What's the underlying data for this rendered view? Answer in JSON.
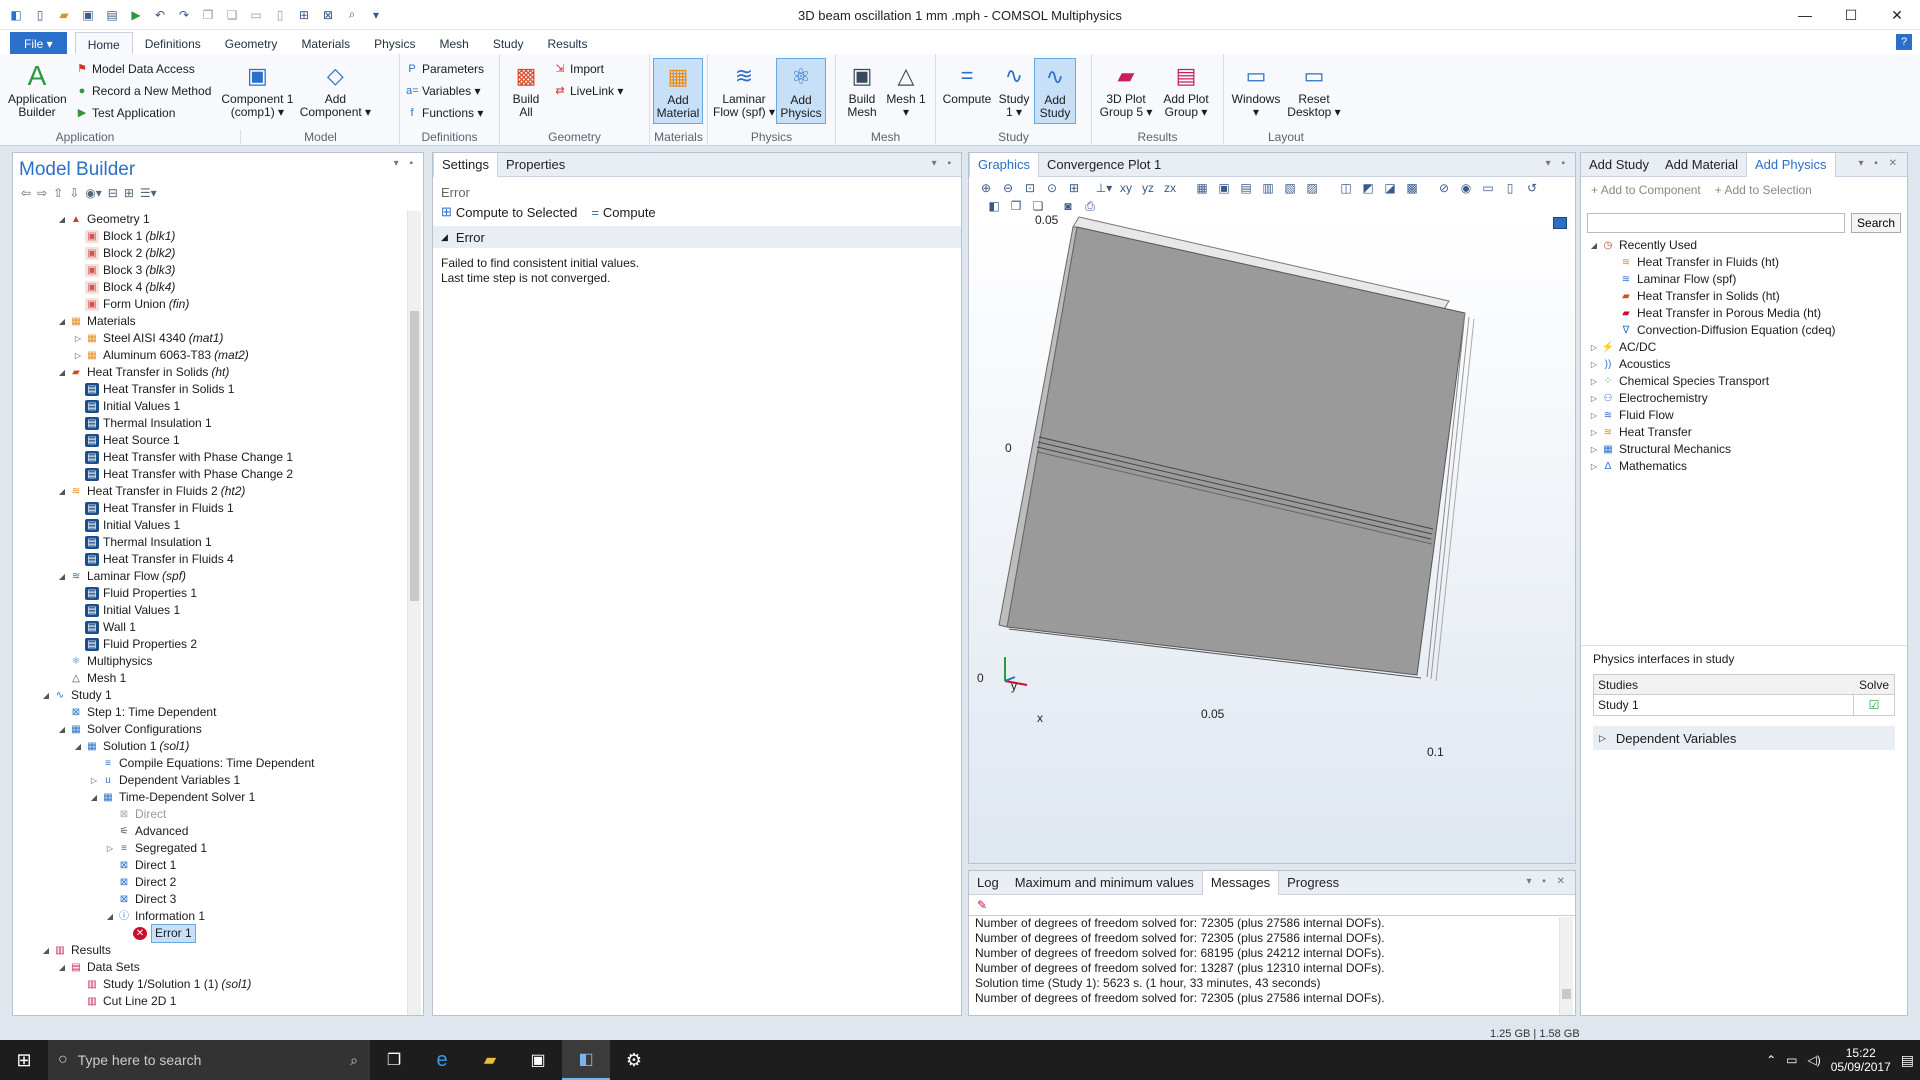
{
  "window": {
    "title": "3D beam oscillation 1 mm .mph - COMSOL Multiphysics"
  },
  "qat_icons": [
    "comsol-logo-icon",
    "new-icon",
    "open-icon",
    "save-icon",
    "save-as-icon",
    "run-icon",
    "undo-icon",
    "redo-icon",
    "copy-icon",
    "duplicate-icon",
    "paste-icon",
    "delete-icon",
    "select-all-icon",
    "clear-icon",
    "zoom-icon",
    "more-icon"
  ],
  "ribbon_tabs": {
    "file": "File ▾",
    "tabs": [
      "Home",
      "Definitions",
      "Geometry",
      "Materials",
      "Physics",
      "Mesh",
      "Study",
      "Results"
    ],
    "active": "Home"
  },
  "ribbon": {
    "application": {
      "label": "Application",
      "app_builder": "Application Builder",
      "model_data_access": "Model Data Access",
      "record_method": "Record a New Method",
      "test_app": "Test Application"
    },
    "model": {
      "label": "Model",
      "component": "Component 1 (comp1) ▾",
      "add_component": "Add Component ▾"
    },
    "definitions": {
      "label": "Definitions",
      "parameters": "Parameters",
      "variables": "Variables ▾",
      "functions": "Functions ▾"
    },
    "geometry": {
      "label": "Geometry",
      "build_all": "Build All",
      "import": "Import",
      "livelink": "LiveLink ▾"
    },
    "materials": {
      "label": "Materials",
      "add_material": "Add Material"
    },
    "physics": {
      "label": "Physics",
      "laminar_flow": "Laminar Flow (spf) ▾",
      "add_physics": "Add Physics"
    },
    "mesh": {
      "label": "Mesh",
      "build_mesh": "Build Mesh",
      "mesh1": "Mesh 1 ▾"
    },
    "study": {
      "label": "Study",
      "compute": "Compute",
      "study1": "Study 1 ▾",
      "add_study": "Add Study"
    },
    "results": {
      "label": "Results",
      "plot_group": "3D Plot Group 5 ▾",
      "add_plot_group": "Add Plot Group ▾"
    },
    "layout": {
      "label": "Layout",
      "windows": "Windows ▾",
      "reset_desktop": "Reset Desktop ▾"
    }
  },
  "model_builder": {
    "title": "Model Builder",
    "tree": [
      {
        "indent": 3,
        "arrow": "◢",
        "icon": "geometry",
        "label": "Geometry 1",
        "tag": ""
      },
      {
        "indent": 4,
        "arrow": "",
        "icon": "block",
        "label": "Block 1",
        "tag": "(blk1)"
      },
      {
        "indent": 4,
        "arrow": "",
        "icon": "block",
        "label": "Block 2",
        "tag": "(blk2)"
      },
      {
        "indent": 4,
        "arrow": "",
        "icon": "block",
        "label": "Block 3",
        "tag": "(blk3)"
      },
      {
        "indent": 4,
        "arrow": "",
        "icon": "block",
        "label": "Block 4",
        "tag": "(blk4)"
      },
      {
        "indent": 4,
        "arrow": "",
        "icon": "block",
        "label": "Form Union",
        "tag": "(fin)"
      },
      {
        "indent": 3,
        "arrow": "◢",
        "icon": "material",
        "label": "Materials",
        "tag": ""
      },
      {
        "indent": 4,
        "arrow": "▷",
        "icon": "material",
        "label": "Steel AISI 4340",
        "tag": "(mat1)"
      },
      {
        "indent": 4,
        "arrow": "▷",
        "icon": "material",
        "label": "Aluminum 6063-T83",
        "tag": "(mat2)"
      },
      {
        "indent": 3,
        "arrow": "◢",
        "icon": "heat",
        "label": "Heat Transfer in Solids",
        "tag": "(ht)"
      },
      {
        "indent": 4,
        "arrow": "",
        "icon": "node",
        "label": "Heat Transfer in Solids 1",
        "tag": ""
      },
      {
        "indent": 4,
        "arrow": "",
        "icon": "node",
        "label": "Initial Values 1",
        "tag": ""
      },
      {
        "indent": 4,
        "arrow": "",
        "icon": "node",
        "label": "Thermal Insulation 1",
        "tag": ""
      },
      {
        "indent": 4,
        "arrow": "",
        "icon": "node",
        "label": "Heat Source 1",
        "tag": ""
      },
      {
        "indent": 4,
        "arrow": "",
        "icon": "node",
        "label": "Heat Transfer with Phase Change 1",
        "tag": ""
      },
      {
        "indent": 4,
        "arrow": "",
        "icon": "node",
        "label": "Heat Transfer with Phase Change 2",
        "tag": ""
      },
      {
        "indent": 3,
        "arrow": "◢",
        "icon": "fluidheat",
        "label": "Heat Transfer in Fluids 2",
        "tag": "(ht2)"
      },
      {
        "indent": 4,
        "arrow": "",
        "icon": "node",
        "label": "Heat Transfer in Fluids 1",
        "tag": ""
      },
      {
        "indent": 4,
        "arrow": "",
        "icon": "node",
        "label": "Initial Values 1",
        "tag": ""
      },
      {
        "indent": 4,
        "arrow": "",
        "icon": "node",
        "label": "Thermal Insulation 1",
        "tag": ""
      },
      {
        "indent": 4,
        "arrow": "",
        "icon": "node",
        "label": "Heat Transfer in Fluids 4",
        "tag": ""
      },
      {
        "indent": 3,
        "arrow": "◢",
        "icon": "flow",
        "label": "Laminar Flow",
        "tag": "(spf)"
      },
      {
        "indent": 4,
        "arrow": "",
        "icon": "node",
        "label": "Fluid Properties 1",
        "tag": ""
      },
      {
        "indent": 4,
        "arrow": "",
        "icon": "node",
        "label": "Initial Values 1",
        "tag": ""
      },
      {
        "indent": 4,
        "arrow": "",
        "icon": "node",
        "label": "Wall 1",
        "tag": ""
      },
      {
        "indent": 4,
        "arrow": "",
        "icon": "node",
        "label": "Fluid Properties 2",
        "tag": ""
      },
      {
        "indent": 3,
        "arrow": "",
        "icon": "multi",
        "label": "Multiphysics",
        "tag": ""
      },
      {
        "indent": 3,
        "arrow": "",
        "icon": "mesh",
        "label": "Mesh 1",
        "tag": ""
      },
      {
        "indent": 2,
        "arrow": "◢",
        "icon": "study",
        "label": "Study 1",
        "tag": ""
      },
      {
        "indent": 3,
        "arrow": "",
        "icon": "step",
        "label": "Step 1: Time Dependent",
        "tag": ""
      },
      {
        "indent": 3,
        "arrow": "◢",
        "icon": "solver",
        "label": "Solver Configurations",
        "tag": ""
      },
      {
        "indent": 4,
        "arrow": "◢",
        "icon": "solver",
        "label": "Solution 1",
        "tag": "(sol1)"
      },
      {
        "indent": 5,
        "arrow": "",
        "icon": "node2",
        "label": "Compile Equations: Time Dependent",
        "tag": ""
      },
      {
        "indent": 5,
        "arrow": "▷",
        "icon": "dep",
        "label": "Dependent Variables 1",
        "tag": ""
      },
      {
        "indent": 5,
        "arrow": "◢",
        "icon": "solver",
        "label": "Time-Dependent Solver 1",
        "tag": ""
      },
      {
        "indent": 6,
        "arrow": "",
        "icon": "direct-dim",
        "label": "Direct",
        "tag": "",
        "dim": true
      },
      {
        "indent": 6,
        "arrow": "",
        "icon": "adv",
        "label": "Advanced",
        "tag": ""
      },
      {
        "indent": 6,
        "arrow": "▷",
        "icon": "seg",
        "label": "Segregated 1",
        "tag": ""
      },
      {
        "indent": 6,
        "arrow": "",
        "icon": "direct",
        "label": "Direct 1",
        "tag": ""
      },
      {
        "indent": 6,
        "arrow": "",
        "icon": "direct",
        "label": "Direct 2",
        "tag": ""
      },
      {
        "indent": 6,
        "arrow": "",
        "icon": "direct",
        "label": "Direct 3",
        "tag": ""
      },
      {
        "indent": 6,
        "arrow": "◢",
        "icon": "info",
        "label": "Information 1",
        "tag": ""
      },
      {
        "indent": 7,
        "arrow": "",
        "icon": "error",
        "label": "Error 1",
        "tag": "",
        "selected": true
      },
      {
        "indent": 2,
        "arrow": "◢",
        "icon": "results",
        "label": "Results",
        "tag": ""
      },
      {
        "indent": 3,
        "arrow": "◢",
        "icon": "data",
        "label": "Data Sets",
        "tag": ""
      },
      {
        "indent": 4,
        "arrow": "",
        "icon": "dataset",
        "label": "Study 1/Solution 1 (1)",
        "tag": "(sol1)"
      },
      {
        "indent": 4,
        "arrow": "",
        "icon": "dataset",
        "label": "Cut Line 2D 1",
        "tag": ""
      }
    ]
  },
  "settings": {
    "tabs": [
      "Settings",
      "Properties"
    ],
    "title": "Error",
    "compute_selected": "Compute to Selected",
    "compute": "Compute",
    "section": "Error",
    "line1": "Failed to find consistent initial values.",
    "line2": "Last time step is not converged."
  },
  "graphics": {
    "tabs": [
      "Graphics",
      "Convergence Plot 1"
    ],
    "axes": {
      "y_top": "0.05",
      "y_mid": "0",
      "y_bot": "0",
      "x_mid": "0.05",
      "x_right": "0.1",
      "y_axis": "y",
      "x_axis": "x"
    }
  },
  "add_physics": {
    "tabs": [
      "Add Study",
      "Add Material",
      "Add Physics"
    ],
    "add_to_component": "Add to Component",
    "add_to_selection": "Add to Selection",
    "search_btn": "Search",
    "search_value": "",
    "tree": [
      {
        "indent": 0,
        "arrow": "◢",
        "label": "Recently Used"
      },
      {
        "indent": 1,
        "arrow": "",
        "label": "Heat Transfer in Fluids (ht)"
      },
      {
        "indent": 1,
        "arrow": "",
        "label": "Laminar Flow (spf)"
      },
      {
        "indent": 1,
        "arrow": "",
        "label": "Heat Transfer in Solids (ht)"
      },
      {
        "indent": 1,
        "arrow": "",
        "label": "Heat Transfer in Porous Media (ht)"
      },
      {
        "indent": 1,
        "arrow": "",
        "label": "Convection-Diffusion Equation (cdeq)"
      },
      {
        "indent": 0,
        "arrow": "▷",
        "label": "AC/DC"
      },
      {
        "indent": 0,
        "arrow": "▷",
        "label": "Acoustics"
      },
      {
        "indent": 0,
        "arrow": "▷",
        "label": "Chemical Species Transport"
      },
      {
        "indent": 0,
        "arrow": "▷",
        "label": "Electrochemistry"
      },
      {
        "indent": 0,
        "arrow": "▷",
        "label": "Fluid Flow"
      },
      {
        "indent": 0,
        "arrow": "▷",
        "label": "Heat Transfer"
      },
      {
        "indent": 0,
        "arrow": "▷",
        "label": "Structural Mechanics"
      },
      {
        "indent": 0,
        "arrow": "▷",
        "label": "Mathematics"
      }
    ],
    "interfaces_title": "Physics interfaces in study",
    "studies_col": "Studies",
    "solve_col": "Solve",
    "study_row": "Study 1",
    "dep_vars": "Dependent Variables"
  },
  "messages": {
    "tabs": [
      "Log",
      "Maximum and minimum values",
      "Messages",
      "Progress"
    ],
    "active": "Messages",
    "lines": [
      "Number of degrees of freedom solved for: 72305 (plus 27586 internal DOFs).",
      "Number of degrees of freedom solved for: 72305 (plus 27586 internal DOFs).",
      "Number of degrees of freedom solved for: 68195 (plus 24212 internal DOFs).",
      "Number of degrees of freedom solved for: 13287 (plus 12310 internal DOFs).",
      "Solution time (Study 1): 5623 s. (1 hour, 33 minutes, 43 seconds)",
      "Number of degrees of freedom solved for: 72305 (plus 27586 internal DOFs)."
    ]
  },
  "status": {
    "memory": "1.25 GB | 1.58 GB"
  },
  "taskbar": {
    "search_placeholder": "Type here to search",
    "time": "15:22",
    "date": "05/09/2017"
  },
  "colors": {
    "accent": "#2a6fc9",
    "error": "#c8102e"
  }
}
